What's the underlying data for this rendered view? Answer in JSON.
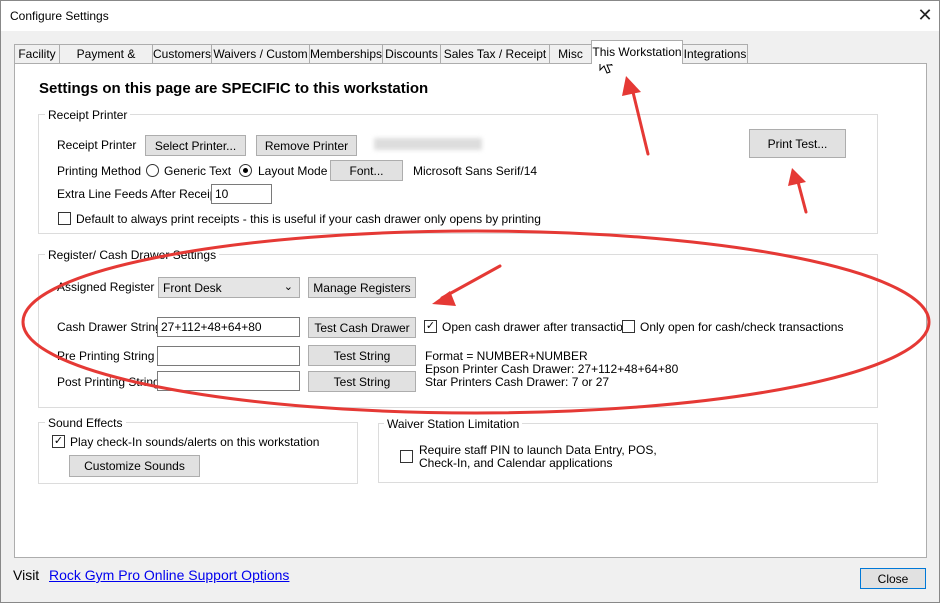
{
  "window": {
    "title": "Configure Settings",
    "close_glyph": "✕"
  },
  "tabs": [
    {
      "label": "Facility"
    },
    {
      "label": "Payment & Billing"
    },
    {
      "label": "Customers"
    },
    {
      "label": "Waivers / Custom"
    },
    {
      "label": "Memberships"
    },
    {
      "label": "Discounts"
    },
    {
      "label": "Sales Tax / Receipt"
    },
    {
      "label": "Misc"
    },
    {
      "label": "This Workstation",
      "active": true
    },
    {
      "label": "Integrations"
    }
  ],
  "heading": "Settings on this page are SPECIFIC to this workstation",
  "receipt_printer": {
    "group_label": "Receipt Printer",
    "printer_label": "Receipt Printer",
    "select_printer": "Select Printer...",
    "remove_printer": "Remove Printer",
    "printing_method_label": "Printing Method",
    "generic_text": "Generic Text",
    "layout_mode": "Layout Mode",
    "font_button": "Font...",
    "font_value": "Microsoft Sans Serif/14",
    "extra_feeds_label": "Extra Line Feeds After Receipt",
    "extra_feeds_value": "10",
    "default_print_label": "Default to always print receipts - this is useful if your cash drawer only opens by printing",
    "print_test": "Print Test..."
  },
  "register": {
    "group_label": "Register/ Cash Drawer Settings",
    "assigned_label": "Assigned Register",
    "assigned_value": "Front Desk",
    "manage_registers": "Manage Registers",
    "cash_string_label": "Cash Drawer String",
    "cash_string_value": "27+112+48+64+80",
    "test_cash_drawer": "Test Cash Drawer",
    "open_after_label": "Open cash drawer after transaction",
    "only_open_label": "Only open for cash/check transactions",
    "pre_label": "Pre Printing String",
    "post_label": "Post Printing String",
    "test_string": "Test String",
    "format_line1": "Format = NUMBER+NUMBER",
    "format_line2": "Epson Printer Cash Drawer: 27+112+48+64+80",
    "format_line3": "Star Printers Cash Drawer: 7 or 27"
  },
  "sound": {
    "group_label": "Sound Effects",
    "play_label": "Play check-In sounds/alerts on this workstation",
    "customize": "Customize Sounds"
  },
  "waiver": {
    "group_label": "Waiver Station Limitation",
    "require_line1": "Require staff PIN to launch Data Entry, POS,",
    "require_line2": "Check-In, and Calendar applications"
  },
  "footer": {
    "visit": "Visit",
    "link": "Rock Gym Pro Online Support Options",
    "close": "Close"
  },
  "annotation_color": "#e53935"
}
